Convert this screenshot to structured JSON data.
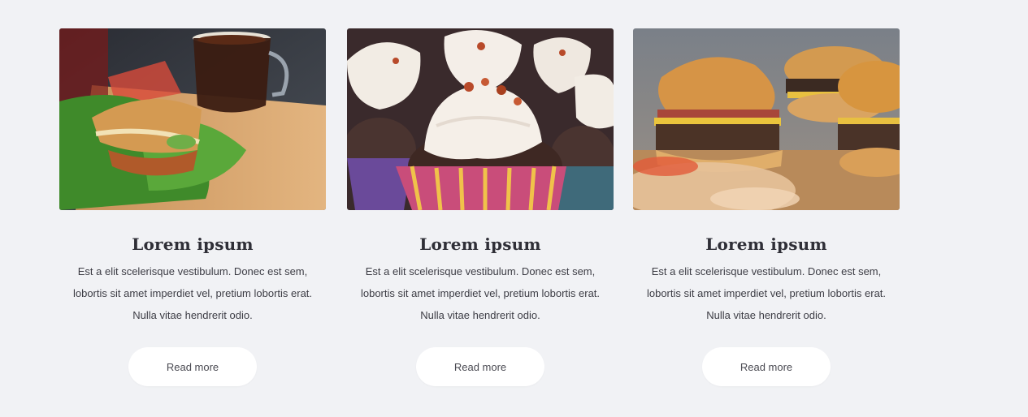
{
  "cards": [
    {
      "title": "Lorem ipsum",
      "text": "Est a elit scelerisque vestibulum. Donec est sem, lobortis sit amet imperdiet vel, pretium lobortis erat. Nulla vitae hendrerit odio.",
      "button": "Read more",
      "image": "sandwich-and-coffee-photo"
    },
    {
      "title": "Lorem ipsum",
      "text": "Est a elit scelerisque vestibulum. Donec est sem, lobortis sit amet imperdiet vel, pretium lobortis erat. Nulla vitae hendrerit odio.",
      "button": "Read more",
      "image": "cupcakes-photo"
    },
    {
      "title": "Lorem ipsum",
      "text": "Est a elit scelerisque vestibulum. Donec est sem, lobortis sit amet imperdiet vel, pretium lobortis erat. Nulla vitae hendrerit odio.",
      "button": "Read more",
      "image": "burgers-photo"
    }
  ],
  "colors": {
    "background": "#f1f2f5",
    "button_bg": "#ffffff",
    "title": "#2f2f37",
    "text": "#3d3d45"
  }
}
